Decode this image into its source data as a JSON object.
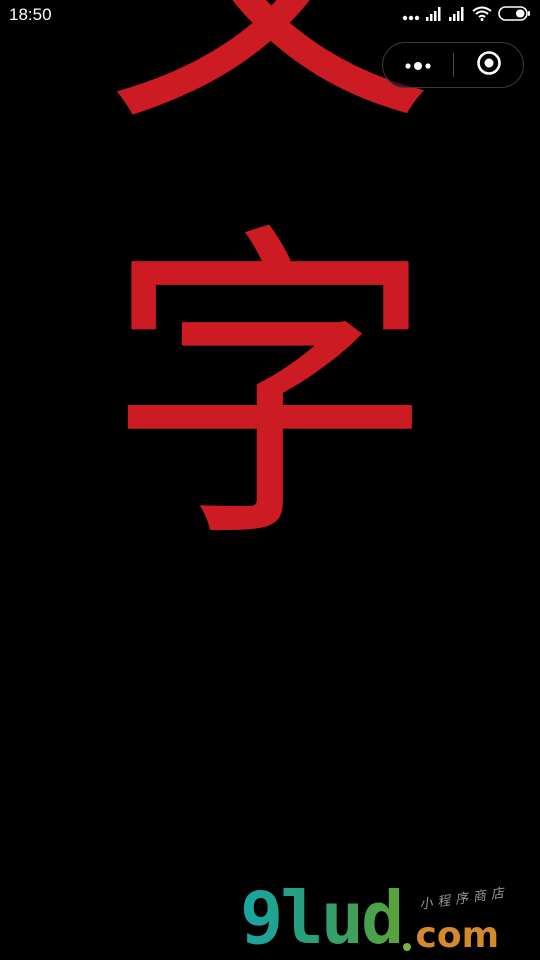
{
  "status_bar": {
    "time": "18:50",
    "icons": [
      "more-dots-icon",
      "signal-icon",
      "signal-icon",
      "wifi-icon",
      "battery-icon"
    ]
  },
  "capsule": {
    "more_icon": "more-dots-icon",
    "close_icon": "target-circle-icon"
  },
  "content": {
    "characters": [
      "文",
      "字"
    ],
    "text_color": "#cc1b22"
  },
  "watermark": {
    "logo": "9lud",
    "domain": "com",
    "tagline": "小程序商店"
  },
  "colors": {
    "background": "#000000",
    "status_text": "#ffffff"
  }
}
